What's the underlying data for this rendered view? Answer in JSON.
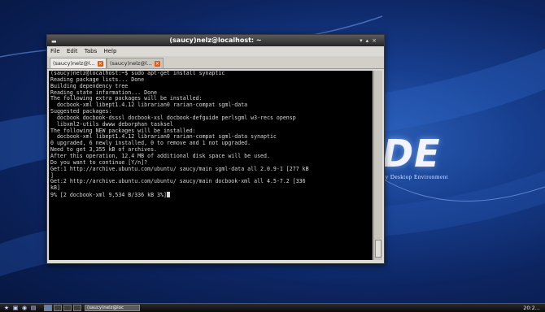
{
  "window": {
    "title": "(saucy)nelz@localhost: ~",
    "menu": [
      "File",
      "Edit",
      "Tabs",
      "Help"
    ],
    "tabs": [
      {
        "label": "(saucy)nelz@l...",
        "active": true
      },
      {
        "label": "(saucy)nelz@l...",
        "active": false
      }
    ]
  },
  "terminal": {
    "lines": [
      "(saucy)nelz@localhost:~$ sudo apt-get install synaptic",
      "Reading package lists... Done",
      "Building dependency tree",
      "Reading state information... Done",
      "The following extra packages will be installed:",
      "  docbook-xml libept1.4.12 librarian0 rarian-compat sgml-data",
      "Suggested packages:",
      "  docbook docbook-dsssl docbook-xsl docbook-defguide perlsgml w3-recs opensp",
      "  libxml2-utils dwww deborphan tasksel",
      "The following NEW packages will be installed:",
      "  docbook-xml libept1.4.12 librarian0 rarian-compat sgml-data synaptic",
      "0 upgraded, 6 newly installed, 0 to remove and 1 not upgraded.",
      "Need to get 3,355 kB of archives.",
      "After this operation, 12.4 MB of additional disk space will be used.",
      "Do you want to continue [Y/n]?",
      "Get:1 http://archive.ubuntu.com/ubuntu/ saucy/main sgml-data all 2.0.9-1 [277 kB",
      "]",
      "Get:2 http://archive.ubuntu.com/ubuntu/ saucy/main docbook-xml all 4.5-7.2 [336",
      "kB]",
      "9% [2 docbook-xml 9,534 B/336 kB 3%]"
    ]
  },
  "desktop": {
    "logo_text": "DE",
    "tagline": "...ity Desktop Environment"
  },
  "taskbar": {
    "task_label": "(saucy)nelz@loc",
    "clock": "20:2..."
  },
  "colors": {
    "terminal_bg": "#000000",
    "terminal_fg": "#d7d7d7",
    "desktop_blue": "#173e8e",
    "tab_close": "#e05a1a"
  },
  "icons": [
    "menu-icon",
    "terminal-icon",
    "browser-icon",
    "folder-icon",
    "close-tab-icon"
  ]
}
